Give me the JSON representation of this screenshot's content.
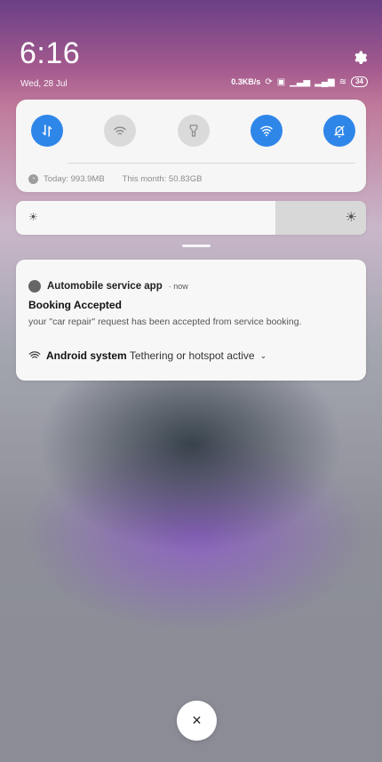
{
  "status_bar": {
    "time": "6:16",
    "date": "Wed, 28 Jul",
    "net_speed": "0.3KB/s",
    "battery": "34"
  },
  "quick_settings": {
    "tiles": [
      {
        "icon": "data-transfer-icon",
        "active": true
      },
      {
        "icon": "wifi-icon",
        "active": false
      },
      {
        "icon": "flashlight-icon",
        "active": false
      },
      {
        "icon": "hotspot-icon",
        "active": true
      },
      {
        "icon": "bell-off-icon",
        "active": true
      }
    ],
    "usage_today": "Today: 993.9MB",
    "usage_month": "This month: 50.83GB",
    "accent": "#2f86e9"
  },
  "brightness": {
    "level": 0.74
  },
  "notification": {
    "app_name": "Automobile service app",
    "time": "· now",
    "title": "Booking Accepted",
    "body": "your \"car repair\" request has been accepted from service booking.",
    "system_app": "Android system",
    "system_text": "Tethering or hotspot active"
  },
  "close_button": {
    "symbol": "×"
  }
}
